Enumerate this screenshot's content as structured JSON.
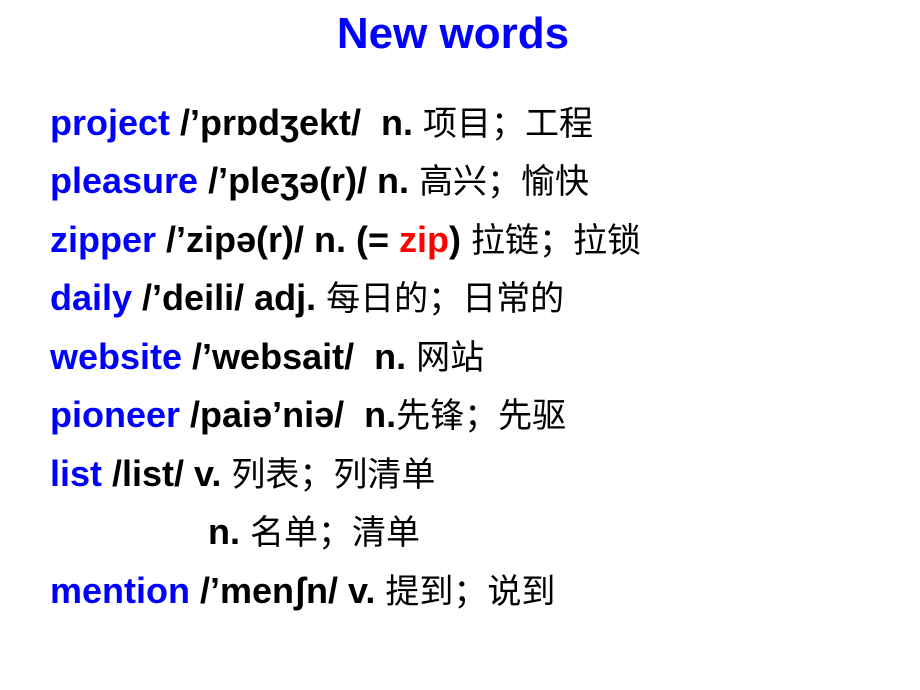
{
  "title": "New words",
  "colors": {
    "headword": "#0000ff",
    "highlight": "#ff0000",
    "text": "#000000"
  },
  "entries": [
    {
      "word": "project",
      "phonetic": " /’prɒdʒekt/  n. ",
      "meaning": "项目；工程"
    },
    {
      "word": "pleasure",
      "phonetic": " /’pleʒə(r)/ n. ",
      "meaning": "高兴；愉快"
    },
    {
      "word": "zipper",
      "phonetic": " /’zipə(r)/ n. (= ",
      "highlight": "zip",
      "after": ") ",
      "meaning": "拉链；拉锁"
    },
    {
      "word": "daily",
      "phonetic": " /’deili/ adj. ",
      "meaning": "每日的；日常的"
    },
    {
      "word": "website",
      "phonetic": " /’websait/  n. ",
      "meaning": "网站"
    },
    {
      "word": "pioneer",
      "phonetic": " /paiə’niə/  n.",
      "meaning": "先锋；先驱"
    },
    {
      "word": "list",
      "phonetic": " /list/ v. ",
      "meaning": "列表；列清单"
    },
    {
      "pos": "n. ",
      "meaning": "名单；清单"
    },
    {
      "word": "mention",
      "phonetic": " /’menʃn/ v. ",
      "meaning": "提到；说到"
    }
  ]
}
